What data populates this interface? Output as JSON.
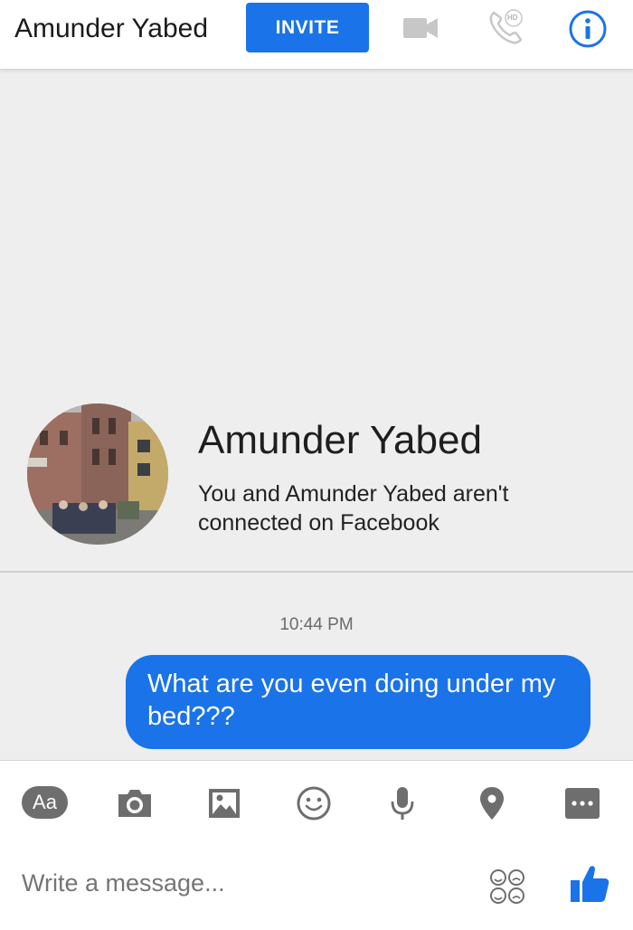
{
  "header": {
    "contact_name": "Amunder Yabed",
    "invite_label": "INVITE",
    "video_icon": "video-camera-icon",
    "call_icon": "phone-hd-icon",
    "call_badge": "HD",
    "info_icon": "info-icon"
  },
  "profile": {
    "name": "Amunder Yabed",
    "subtitle": "You and Amunder Yabed aren't connected on Facebook"
  },
  "conversation": {
    "timestamp": "10:44 PM",
    "messages": [
      {
        "text": "What are you even doing under my bed???"
      }
    ]
  },
  "composer": {
    "text_style_label": "Aa",
    "tools": [
      "camera-icon",
      "image-icon",
      "emoji-icon",
      "microphone-icon",
      "location-icon",
      "more-icon"
    ],
    "placeholder": "Write a message...",
    "emoji_grid_icon": "emoji-grid-icon",
    "like_icon": "thumbs-up-icon"
  },
  "colors": {
    "accent": "#1a73e8",
    "background": "#eeeeee",
    "icon_gray": "#6e6e6e"
  }
}
